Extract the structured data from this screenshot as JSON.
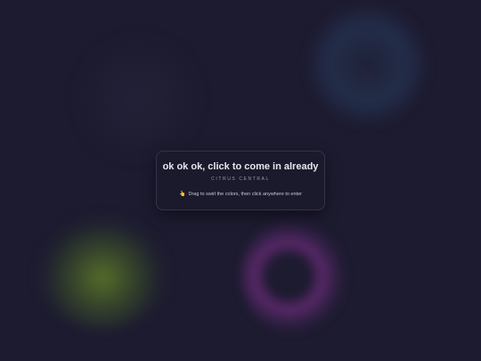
{
  "intro": {
    "title": "ok ok ok, click to come in already",
    "subtitle": "CITRUS CENTRAL",
    "hint_icon": "👆",
    "hint": "Drag to swirl the colors, then click anywhere to enter"
  },
  "colors": {
    "background": "#1d1b30",
    "blob_blue": "#283e5f",
    "blob_green": "#5f7d28",
    "blob_purple": "#6e2d7d",
    "card": "#1a1a2c"
  },
  "icons": {
    "hint": "pointing-hand-icon"
  }
}
